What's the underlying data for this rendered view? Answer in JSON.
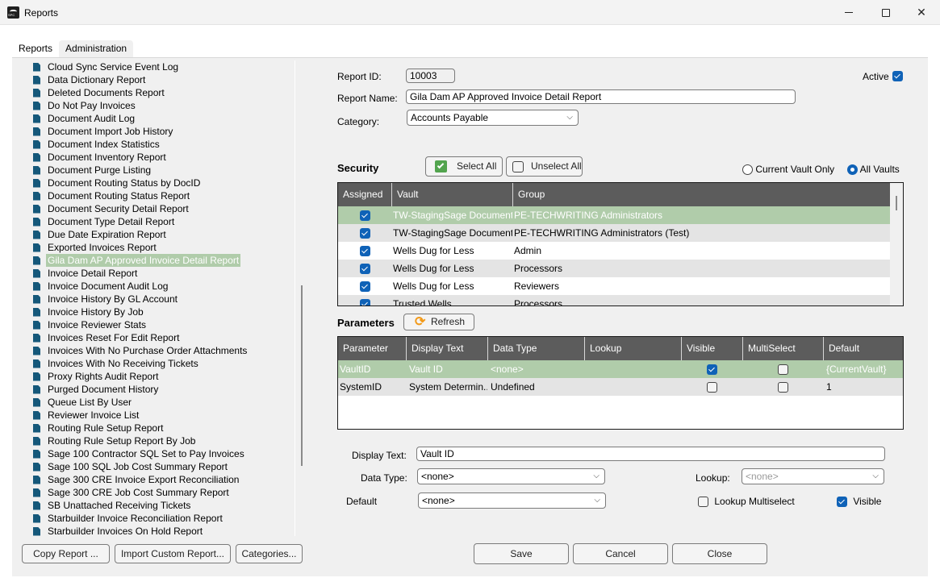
{
  "window": {
    "title": "Reports",
    "icon": "spc-app-icon",
    "controls": {
      "minimize": "minimize-icon",
      "maximize": "maximize-icon",
      "close": "close-icon"
    }
  },
  "tabs": [
    {
      "label": "Reports",
      "active": false
    },
    {
      "label": "Administration",
      "active": true
    }
  ],
  "report_list": {
    "items": [
      "Cloud Sync Service Event Log",
      "Data Dictionary Report",
      "Deleted Documents Report",
      "Do Not Pay Invoices",
      "Document Audit Log",
      "Document Import Job History",
      "Document Index Statistics",
      "Document Inventory Report",
      "Document Purge Listing",
      "Document Routing Status by DocID",
      "Document Routing Status Report",
      "Document Security Detail Report",
      "Document Type Detail Report",
      "Due Date Expiration Report",
      "Exported Invoices Report",
      "Gila Dam  AP Approved Invoice Detail Report",
      "Invoice Detail Report",
      "Invoice Document Audit Log",
      "Invoice History By GL Account",
      "Invoice History By Job",
      "Invoice Reviewer Stats",
      "Invoices Reset For Edit Report",
      "Invoices With No Purchase Order Attachments",
      "Invoices With No Receiving Tickets",
      "Proxy Rights Audit Report",
      "Purged Document History",
      "Queue List By User",
      "Reviewer Invoice List",
      "Routing Rule Setup Report",
      "Routing Rule Setup Report By Job",
      "Sage 100 Contractor SQL Set to Pay Invoices",
      "Sage 100 SQL Job Cost Summary Report",
      "Sage 300 CRE Invoice Export Reconciliation",
      "Sage 300 CRE Job Cost Summary Report",
      "SB Unattached Receiving Tickets",
      "Starbuilder Invoice Reconciliation Report",
      "Starbuilder Invoices On Hold Report"
    ],
    "selected_index": 15,
    "buttons": {
      "copy": "Copy Report ...",
      "import": "Import Custom Report...",
      "categories": "Categories..."
    }
  },
  "details": {
    "report_id_label": "Report ID:",
    "report_id": "10003",
    "report_name_label": "Report Name:",
    "report_name": "Gila Dam  AP Approved Invoice Detail Report",
    "category_label": "Category:",
    "category": "Accounts Payable",
    "active_label": "Active",
    "active": true
  },
  "security": {
    "title": "Security",
    "select_all": "Select All",
    "unselect_all": "Unselect All",
    "scope_options": [
      {
        "label": "Current Vault Only",
        "selected": false
      },
      {
        "label": "All Vaults",
        "selected": true
      }
    ],
    "columns": [
      "Assigned",
      "Vault",
      "Group"
    ],
    "rows": [
      {
        "assigned": true,
        "vault": "TW-StagingSage Documents",
        "group": "PE-TECHWRITING Administrators",
        "selected": true
      },
      {
        "assigned": true,
        "vault": "TW-StagingSage Document...",
        "group": "PE-TECHWRITING Administrators (Test)",
        "selected": false
      },
      {
        "assigned": true,
        "vault": "Wells Dug for Less",
        "group": "Admin",
        "selected": false
      },
      {
        "assigned": true,
        "vault": "Wells Dug for Less",
        "group": "Processors",
        "selected": false
      },
      {
        "assigned": true,
        "vault": "Wells Dug for Less",
        "group": "Reviewers",
        "selected": false
      },
      {
        "assigned": true,
        "vault": "Trusted Wells",
        "group": "Processors",
        "selected": false
      }
    ]
  },
  "parameters": {
    "title": "Parameters",
    "refresh": "Refresh",
    "columns": [
      "Parameter",
      "Display Text",
      "Data Type",
      "Lookup",
      "Visible",
      "MultiSelect",
      "Default"
    ],
    "rows": [
      {
        "parameter": "VaultID",
        "display_text": "Vault ID",
        "data_type": "<none>",
        "lookup": "",
        "visible": true,
        "multiselect": false,
        "default": "{CurrentVault}",
        "selected": true
      },
      {
        "parameter": "SystemID",
        "display_text": "System Determin...",
        "data_type": "Undefined",
        "lookup": "",
        "visible": false,
        "multiselect": false,
        "default": "1",
        "selected": false
      }
    ]
  },
  "param_editor": {
    "display_text_label": "Display Text:",
    "display_text": "Vault ID",
    "data_type_label": "Data Type:",
    "data_type": "<none>",
    "lookup_label": "Lookup:",
    "lookup": "<none>",
    "default_label": "Default",
    "default": "<none>",
    "lookup_multiselect_label": "Lookup Multiselect",
    "lookup_multiselect": false,
    "visible_label": "Visible",
    "visible": true
  },
  "footer": {
    "save": "Save",
    "cancel": "Cancel",
    "close": "Close"
  },
  "colors": {
    "selection": "#b0ccaa",
    "grid_header": "#5c5c5c",
    "checkbox_accent": "#0f62b7",
    "doc_icon": "#15587a"
  }
}
